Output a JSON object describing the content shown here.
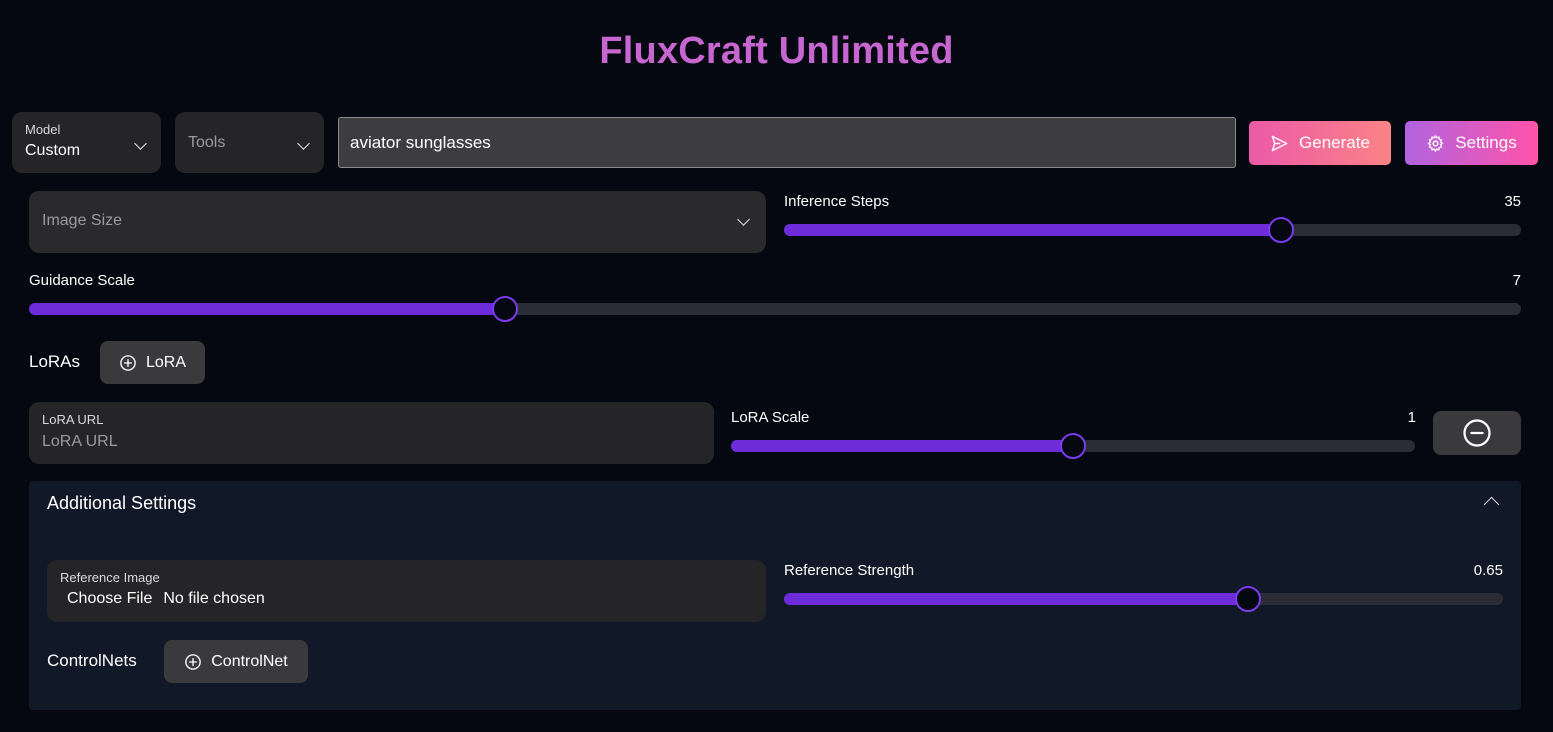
{
  "app": {
    "title": "FluxCraft Unlimited"
  },
  "toolbar": {
    "model": {
      "label": "Model",
      "value": "Custom"
    },
    "tools": {
      "placeholder": "Tools"
    },
    "prompt": {
      "value": "aviator sunglasses"
    },
    "generate_label": "Generate",
    "settings_label": "Settings"
  },
  "image_size": {
    "placeholder": "Image Size"
  },
  "inference_steps": {
    "label": "Inference Steps",
    "value": "35",
    "fraction": 0.675
  },
  "guidance_scale": {
    "label": "Guidance Scale",
    "value": "7",
    "fraction": 0.319
  },
  "loras": {
    "label": "LoRAs",
    "add_label": "LoRA",
    "items": [
      {
        "url_label": "LoRA URL",
        "url_placeholder": "LoRA URL",
        "scale_label": "LoRA Scale",
        "scale_value": "1",
        "fraction": 0.5
      }
    ]
  },
  "additional": {
    "title": "Additional Settings",
    "reference_image": {
      "label": "Reference Image",
      "button": "Choose File",
      "status": "No file chosen"
    },
    "reference_strength": {
      "label": "Reference Strength",
      "value": "0.65",
      "fraction": 0.645
    },
    "controlnets": {
      "label": "ControlNets",
      "add_label": "ControlNet"
    }
  },
  "colors": {
    "title": "#c766d0",
    "slider_fill": "#6d2bd9",
    "slider_thumb_border": "#7b3bf0",
    "panel_bg": "#111827",
    "background": "#050711"
  }
}
